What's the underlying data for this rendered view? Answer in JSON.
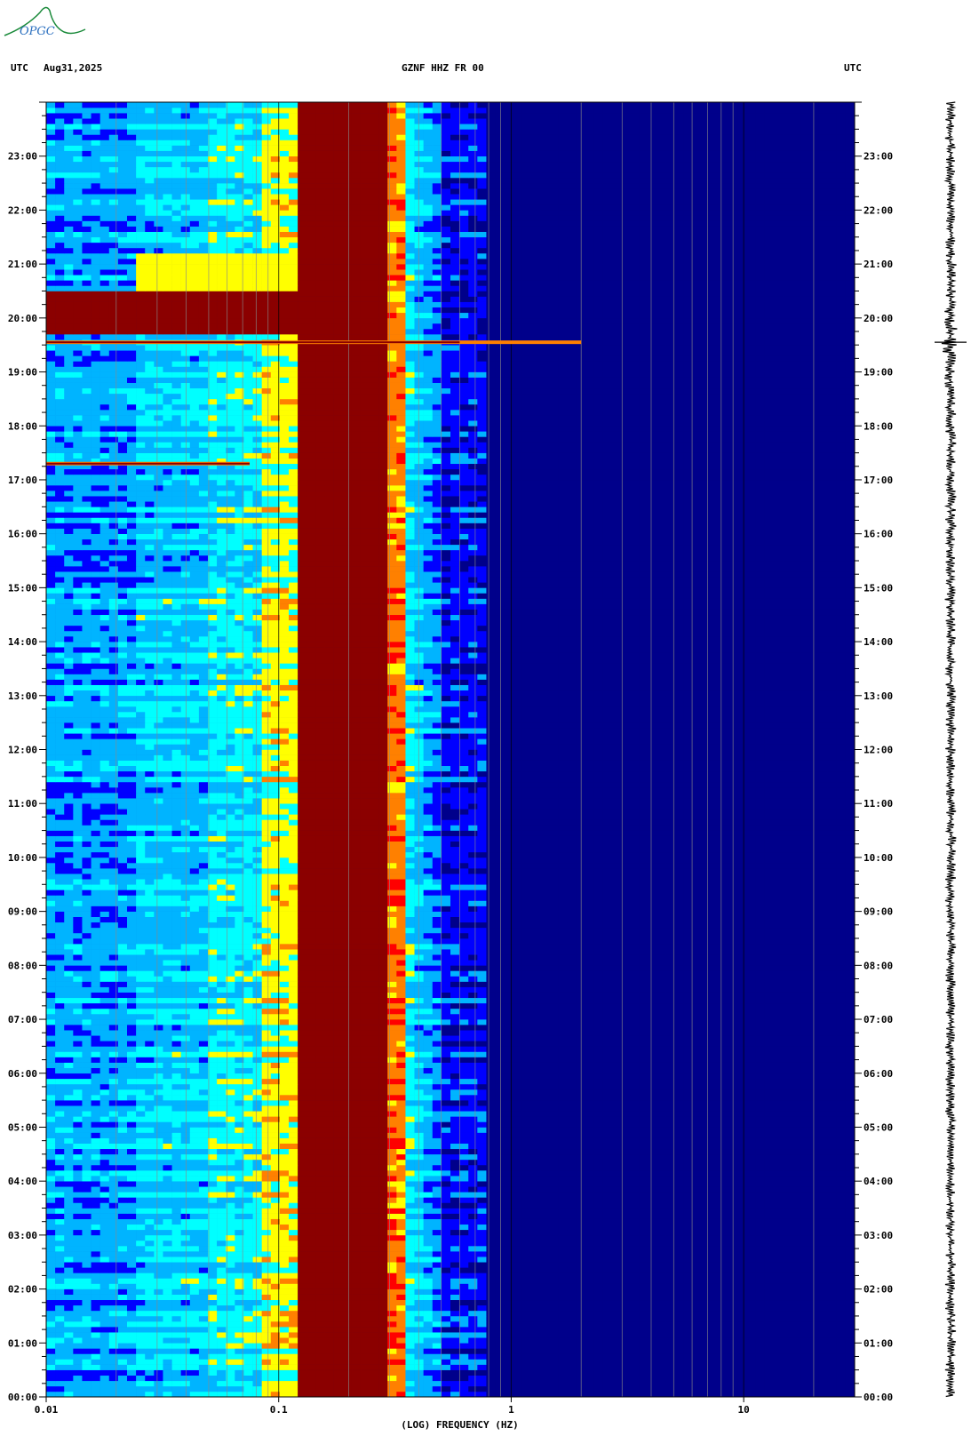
{
  "header": {
    "left_tz": "UTC",
    "date": "Aug31,2025",
    "station": "GZNF HHZ FR 00",
    "right_tz": "UTC"
  },
  "logo": {
    "text": "OPGC"
  },
  "chart_data": {
    "type": "heatmap",
    "title": "GZNF HHZ FR 00",
    "xlabel": "(LOG) FREQUENCY (HZ)",
    "x_scale": "log",
    "xlim": [
      0.01,
      30
    ],
    "x_ticks": [
      0.01,
      0.1,
      1,
      10
    ],
    "x_tick_labels": [
      "0.01",
      "0.1",
      "1",
      "10"
    ],
    "ylim_hours": [
      0,
      24
    ],
    "y_ticks": [
      "00:00",
      "01:00",
      "02:00",
      "03:00",
      "04:00",
      "05:00",
      "06:00",
      "07:00",
      "08:00",
      "09:00",
      "10:00",
      "11:00",
      "12:00",
      "13:00",
      "14:00",
      "15:00",
      "16:00",
      "17:00",
      "18:00",
      "19:00",
      "20:00",
      "21:00",
      "22:00",
      "23:00"
    ],
    "microseism_band_hz": [
      0.12,
      0.3
    ],
    "events": [
      {
        "hour": 19.55,
        "freq_max_hz": 2.0,
        "label": ""
      },
      {
        "hour": 17.3,
        "freq_max_hz": 0.075,
        "label": ""
      }
    ],
    "colormap": [
      "#00008b",
      "#0000ff",
      "#00b4ff",
      "#00ffff",
      "#ffff00",
      "#ff8000",
      "#ff0000",
      "#8b0000"
    ]
  },
  "trace": {
    "event_hour": 19.55
  }
}
